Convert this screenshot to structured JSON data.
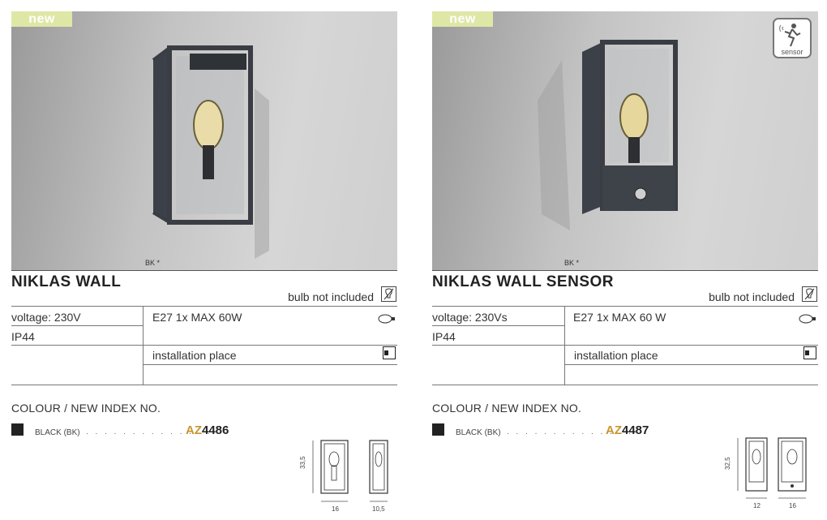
{
  "products": [
    {
      "badge": "new",
      "photo_caption": "BK *",
      "title": "NIKLAS WALL",
      "bulb_note": "bulb not included",
      "specs": {
        "voltage": "voltage: 230V",
        "ip": "IP44",
        "bulb": "E27 1x MAX 60W",
        "installation": "installation place"
      },
      "colour_heading": "COLOUR / NEW INDEX NO.",
      "colour_label": "BLACK (BK)",
      "index_prefix": "AZ",
      "index_number": "4486",
      "dimensions": {
        "height": "33,5",
        "width": "16",
        "depth": "10,5"
      }
    },
    {
      "badge": "new",
      "photo_caption": "BK *",
      "title": "NIKLAS WALL SENSOR",
      "sensor_label": "sensor",
      "bulb_note": "bulb not included",
      "specs": {
        "voltage": "voltage: 230Vs",
        "ip": "IP44",
        "bulb": "E27 1x MAX 60 W",
        "installation": "installation place"
      },
      "colour_heading": "COLOUR / NEW INDEX NO.",
      "colour_label": "BLACK (BK)",
      "index_prefix": "AZ",
      "index_number": "4487",
      "dimensions": {
        "height": "32,5",
        "width": "12",
        "depth": "16"
      }
    }
  ],
  "colors": {
    "badge": "#dfe7a6",
    "index_prefix": "#c9952e",
    "swatch": "#222222"
  },
  "icons": [
    "bulb-not-included-icon",
    "lamp-bulb-icon",
    "installation-place-icon",
    "sensor-icon"
  ]
}
